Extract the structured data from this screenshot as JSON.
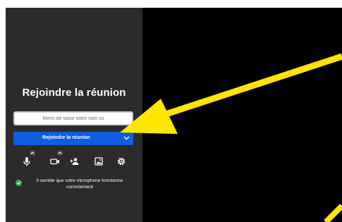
{
  "join": {
    "title": "Rejoindre la réunion",
    "name_placeholder": "Merci de saisir votre nom ici",
    "name_value": "",
    "join_button_label": "Rejoindre la réunion"
  },
  "toolbar": {
    "icons": [
      "microphone-icon",
      "camera-icon",
      "invite-icon",
      "background-icon",
      "settings-icon"
    ]
  },
  "status": {
    "message": "Il semble que votre microphone fonctionne correctement",
    "color": "#2fb34a"
  },
  "colors": {
    "panel": "#2b2b2b",
    "stage": "#000000",
    "accent": "#0e5ee0",
    "annotation": "#ffe600"
  }
}
